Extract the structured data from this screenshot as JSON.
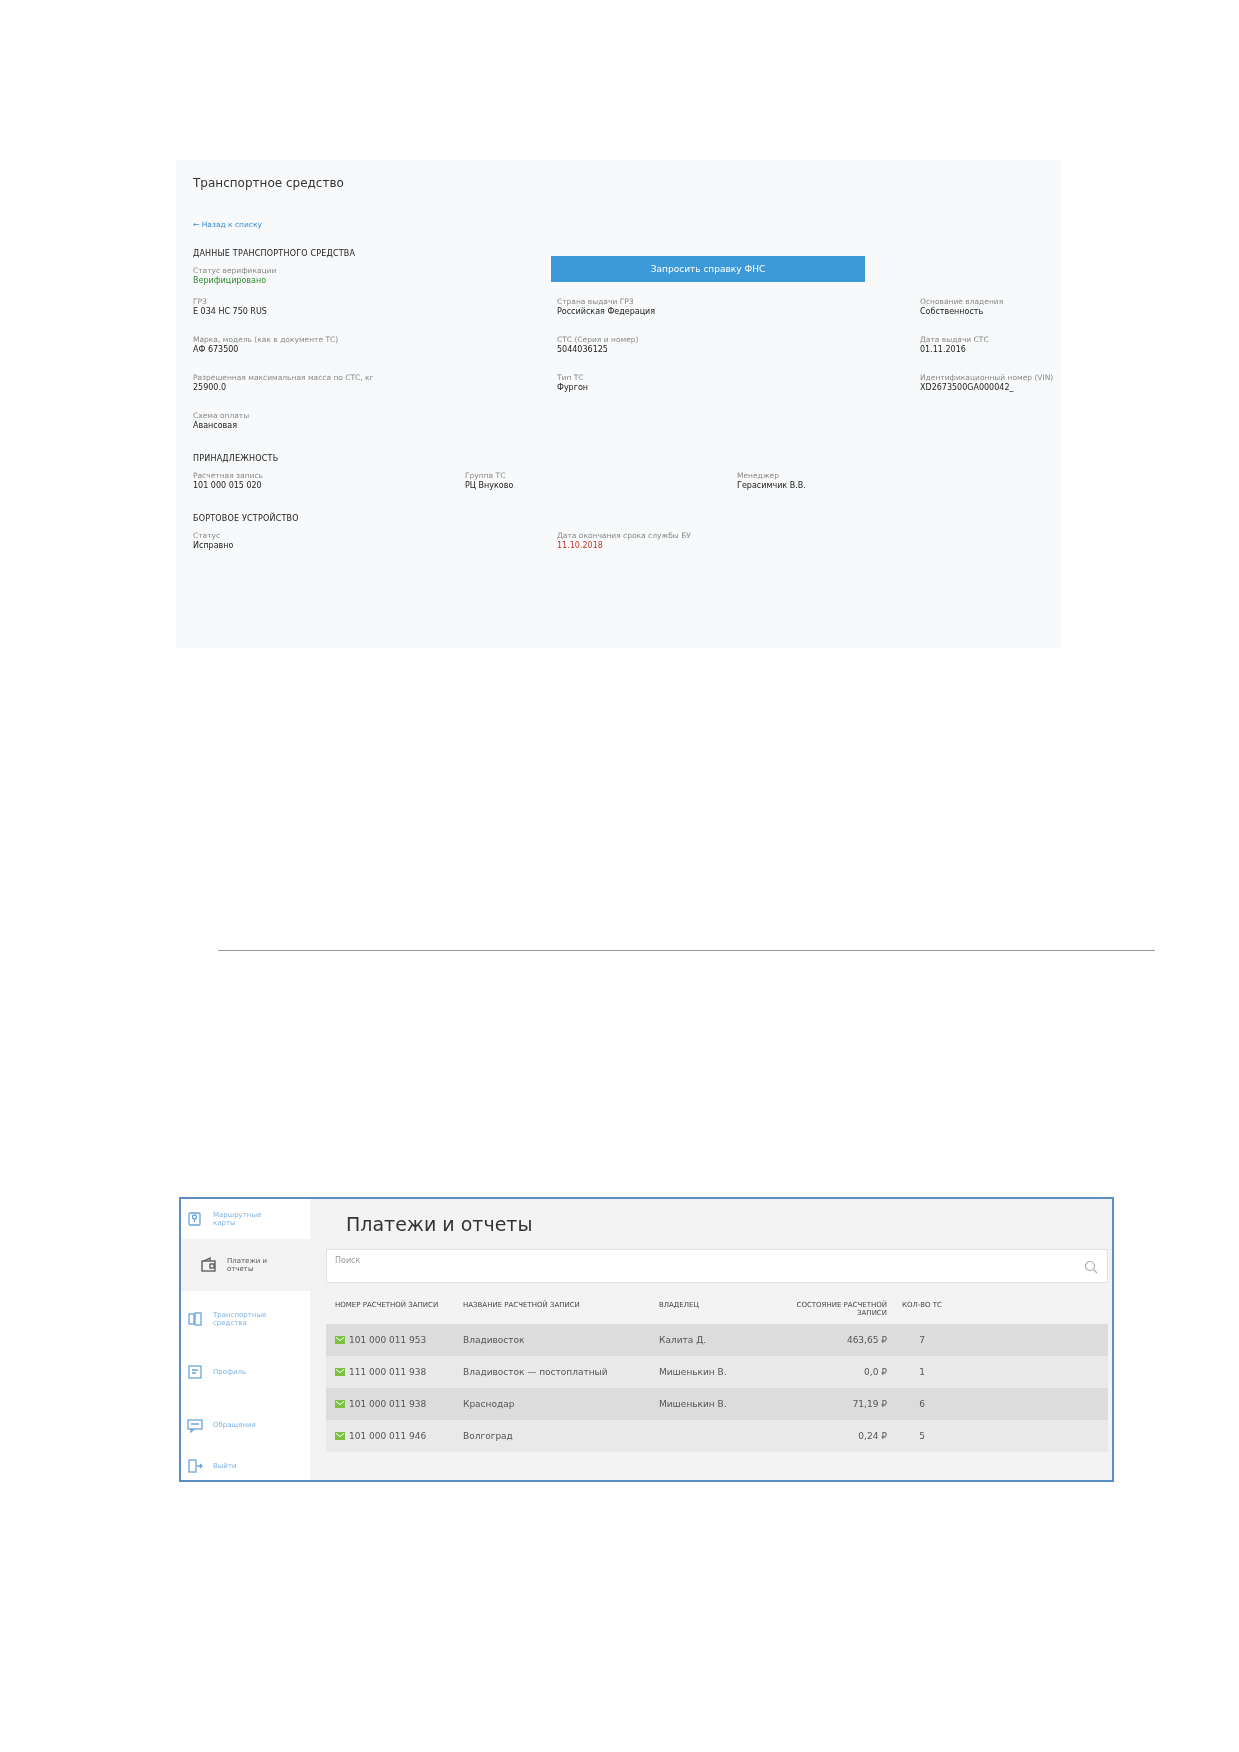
{
  "vehicle_card": {
    "title": "Транспортное средство",
    "back_link": "← Назад к списку",
    "vehicle_data": {
      "heading": "ДАННЫЕ ТРАНСПОРТНОГО СРЕДСТВА",
      "verification": {
        "label": "Статус верификации",
        "value": "Верифицировано",
        "verified": true
      },
      "request_button": "Запросить справку ФНС",
      "fields": [
        {
          "label": "ГРЗ",
          "value": "Е 034 НС 750 RUS"
        },
        {
          "label": "Страна выдачи ГРЗ",
          "value": "Российская Федерация"
        },
        {
          "label": "Основание владения",
          "value": "Собственность"
        },
        {
          "label": "Марка, модель (как в документе ТС)",
          "value": "АФ 673500"
        },
        {
          "label": "СТС (Серия и номер)",
          "value": "5044036125"
        },
        {
          "label": "Дата выдачи СТС",
          "value": "01.11.2016"
        },
        {
          "label": "Разрешенная максимальная масса по СТС, кг",
          "value": "25900.0"
        },
        {
          "label": "Тип ТС",
          "value": "Фургон"
        },
        {
          "label": "Идентификационный номер (VIN)",
          "value": "XD2673500GA000042_"
        },
        {
          "label": "Схема оплаты",
          "value": "Авансовая"
        }
      ]
    },
    "ownership": {
      "heading": "ПРИНАДЛЕЖНОСТЬ",
      "fields": [
        {
          "label": "Расчетная запись",
          "value": "101 000 015 020"
        },
        {
          "label": "Группа ТС",
          "value": "РЦ Внуково"
        },
        {
          "label": "Менеджер",
          "value": "Герасимчик В.В."
        }
      ]
    },
    "onboard_device": {
      "heading": "БОРТОВОЕ УСТРОЙСТВО",
      "fields": [
        {
          "label": "Статус",
          "value": "Исправно",
          "expired": false
        },
        {
          "label": "Дата окончания срока службы БУ",
          "value": "11.10.2018",
          "expired": true
        }
      ]
    }
  },
  "payments_screen": {
    "sidebar": {
      "items": [
        {
          "label": "Маршрутные карты",
          "selected": false
        },
        {
          "label": "Платежи и отчеты",
          "selected": true
        },
        {
          "label": "Транспортные средства",
          "selected": false
        },
        {
          "label": "Профиль",
          "selected": false
        },
        {
          "label": "Обращения",
          "selected": false
        },
        {
          "label": "Выйти",
          "selected": false
        }
      ]
    },
    "title": "Платежи и отчеты",
    "search": {
      "placeholder": "Поиск"
    },
    "table": {
      "columns": [
        "НОМЕР РАСЧЕТНОЙ ЗАПИСИ",
        "НАЗВАНИЕ РАСЧЕТНОЙ ЗАПИСИ",
        "ВЛАДЕЛЕЦ",
        "СОСТОЯНИЕ РАСЧЕТНОЙ ЗАПИСИ",
        "КОЛ-ВО ТС"
      ],
      "rows": [
        {
          "number": "101 000 011 953",
          "name": "Владивосток",
          "owner": "Калита Д.",
          "balance": "463,65 ₽",
          "vehicles": "7"
        },
        {
          "number": "111 000 011 938",
          "name": "Владивосток — постоплатный",
          "owner": "Мишенькин В.",
          "balance": "0,0 ₽",
          "vehicles": "1"
        },
        {
          "number": "101 000 011 938",
          "name": "Краснодар",
          "owner": "Мишенькин В.",
          "balance": "71,19 ₽",
          "vehicles": "6"
        },
        {
          "number": "101 000 011 946",
          "name": "Волгоград",
          "owner": "",
          "balance": "0,24 ₽",
          "vehicles": "5"
        }
      ]
    }
  }
}
